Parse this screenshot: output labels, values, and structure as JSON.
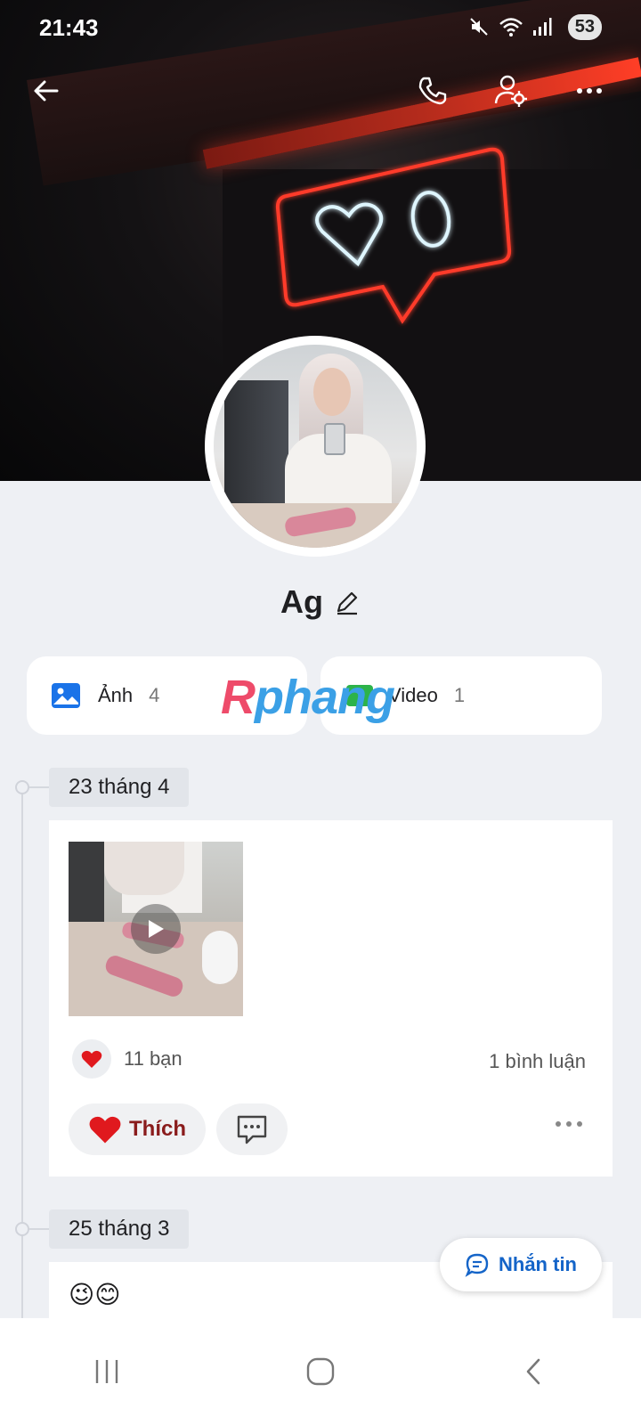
{
  "status_bar": {
    "time": "21:43",
    "battery": "53",
    "icons": [
      "mute-icon",
      "wifi-icon",
      "signal-icon"
    ]
  },
  "header": {
    "back_icon": "back-arrow-icon",
    "call_icon": "phone-icon",
    "settings_icon": "user-settings-icon",
    "more_icon": "more-horizontal-icon"
  },
  "profile": {
    "name": "Ag",
    "edit_icon": "pencil-icon"
  },
  "media": {
    "photos": {
      "label": "Ảnh",
      "count": "4",
      "icon": "image-icon"
    },
    "videos": {
      "label": "Video",
      "count": "1",
      "icon": "video-icon"
    }
  },
  "watermark": {
    "part1": "R",
    "part2": "phang"
  },
  "timeline": [
    {
      "date": "23 tháng 4",
      "type": "video",
      "reaction_count": "11 bạn",
      "comment_count": "1 bình luận",
      "like_label": "Thích"
    },
    {
      "date": "25 tháng 3",
      "text": "😉😊"
    }
  ],
  "message_button": {
    "label": "Nhắn tin",
    "icon": "chat-icon"
  },
  "colors": {
    "accent_blue": "#1464c8",
    "like_red": "#e0191e",
    "background": "#eef0f4"
  }
}
